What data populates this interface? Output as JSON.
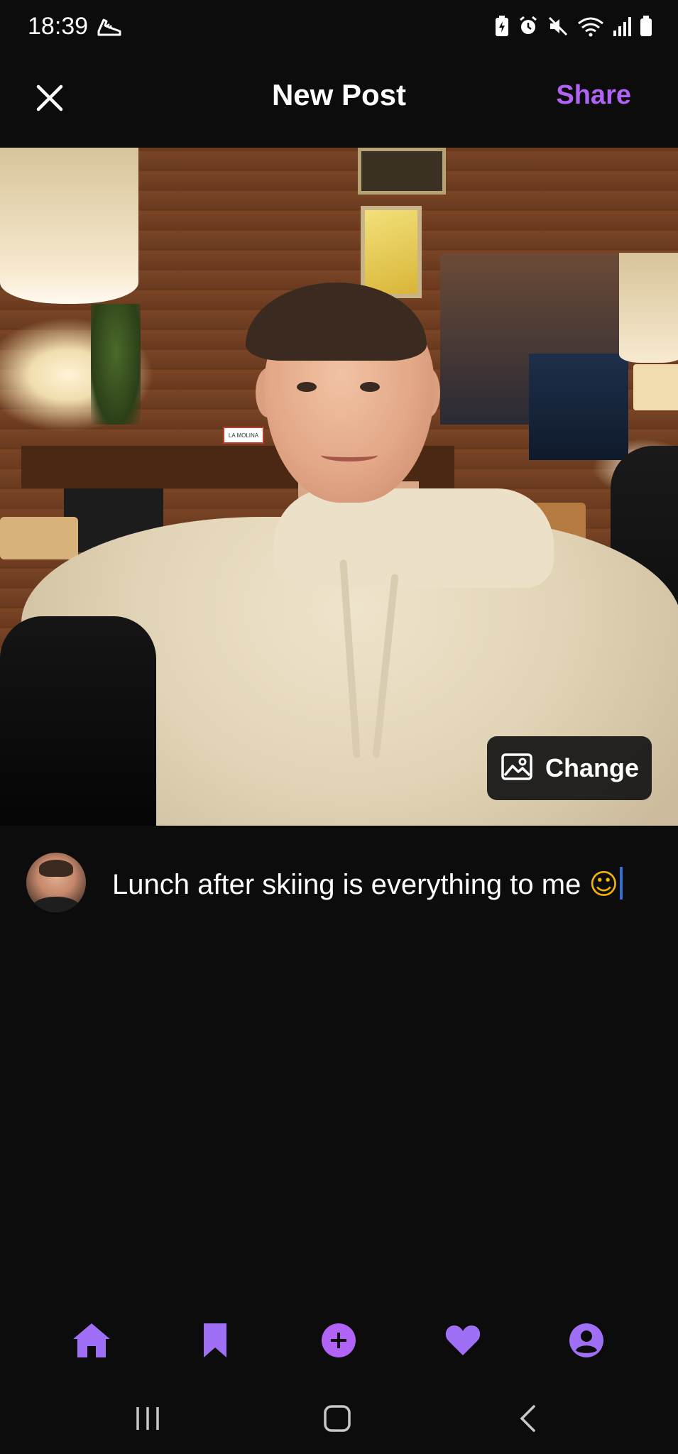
{
  "status_bar": {
    "time": "18:39",
    "left_icons": [
      "shoe-icon"
    ],
    "right_icons": [
      "battery-saver-icon",
      "alarm-icon",
      "mute-icon",
      "wifi-icon",
      "signal-icon",
      "battery-icon"
    ]
  },
  "header": {
    "title": "New Post",
    "share_label": "Share",
    "close_icon": "close-icon"
  },
  "photo": {
    "sign_text": "LA MOLINA",
    "change_label": "Change",
    "change_icon": "image-icon"
  },
  "composer": {
    "caption_text": "Lunch after skiing is everything to me",
    "caption_emoji": "☺"
  },
  "bottom_nav": {
    "items": [
      {
        "icon": "home-icon"
      },
      {
        "icon": "bookmark-icon"
      },
      {
        "icon": "add-icon"
      },
      {
        "icon": "heart-icon"
      },
      {
        "icon": "profile-icon"
      }
    ]
  },
  "system_nav": {
    "items": [
      "recent-apps-icon",
      "home-button-icon",
      "back-icon"
    ]
  },
  "colors": {
    "background": "#0c0c0c",
    "accent": "#b063f5",
    "nav_icon": "#9f6ff5",
    "text": "#ffffff",
    "cursor": "#2f6fd6"
  }
}
